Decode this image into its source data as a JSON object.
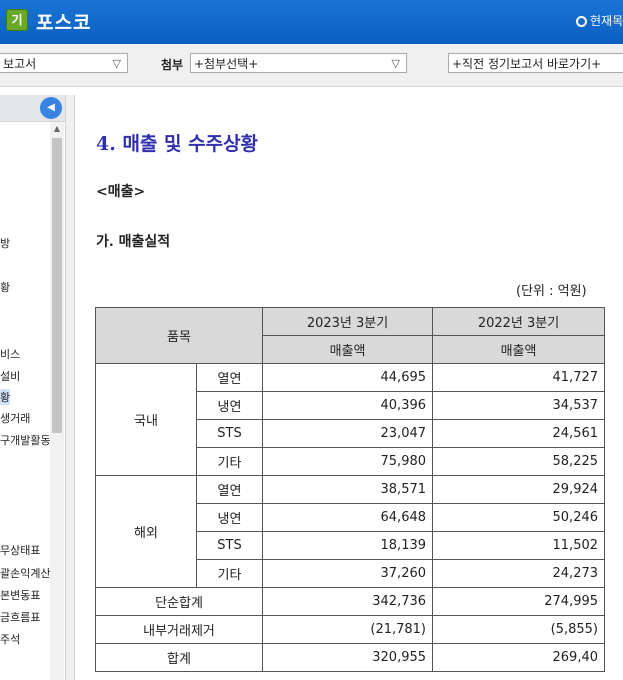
{
  "header": {
    "logo_badge": "기",
    "company": "포스코",
    "current_link": "현재목"
  },
  "toolbar": {
    "report_select": "보고서",
    "attach_label": "첨부",
    "attach_select": "+첨부선택+",
    "prev_report_select": "+직전 정기보고서 바로가기+"
  },
  "left_panel": {
    "items": [
      {
        "label": "방",
        "selected": false
      },
      {
        "label": "황",
        "selected": false
      },
      {
        "label": "비스",
        "selected": false
      },
      {
        "label": "설비",
        "selected": false
      },
      {
        "label": "황",
        "selected": true
      },
      {
        "label": "생거래",
        "selected": false
      },
      {
        "label": "구개발활동",
        "selected": false
      },
      {
        "label": "무상태표",
        "selected": false
      },
      {
        "label": "괄손익계산",
        "selected": false
      },
      {
        "label": "본변동표",
        "selected": false
      },
      {
        "label": "금흐름표",
        "selected": false
      },
      {
        "label": "주석",
        "selected": false
      }
    ]
  },
  "content": {
    "section_title": "4. 매출 및 수주상황",
    "subsection": "<매출>",
    "sub_heading": "가. 매출실적",
    "unit": "(단위 : 억원)",
    "table": {
      "header_item": "품목",
      "period_2023": "2023년 3분기",
      "period_2022": "2022년 3분기",
      "metric_2023": "매출액",
      "metric_2022": "매출액",
      "groups": [
        {
          "name": "국내",
          "rows": [
            {
              "product": "열연",
              "v2023": "44,695",
              "v2022": "41,727"
            },
            {
              "product": "냉연",
              "v2023": "40,396",
              "v2022": "34,537"
            },
            {
              "product": "STS",
              "v2023": "23,047",
              "v2022": "24,561"
            },
            {
              "product": "기타",
              "v2023": "75,980",
              "v2022": "58,225"
            }
          ]
        },
        {
          "name": "해외",
          "rows": [
            {
              "product": "열연",
              "v2023": "38,571",
              "v2022": "29,924"
            },
            {
              "product": "냉연",
              "v2023": "64,648",
              "v2022": "50,246"
            },
            {
              "product": "STS",
              "v2023": "18,139",
              "v2022": "11,502"
            },
            {
              "product": "기타",
              "v2023": "37,260",
              "v2022": "24,273"
            }
          ]
        }
      ],
      "totals": [
        {
          "label": "단순합계",
          "v2023": "342,736",
          "v2022": "274,995"
        },
        {
          "label": "내부거래제거",
          "v2023": "(21,781)",
          "v2022": "(5,855)"
        },
        {
          "label": "합계",
          "v2023": "320,955",
          "v2022": "269,40"
        }
      ]
    }
  }
}
